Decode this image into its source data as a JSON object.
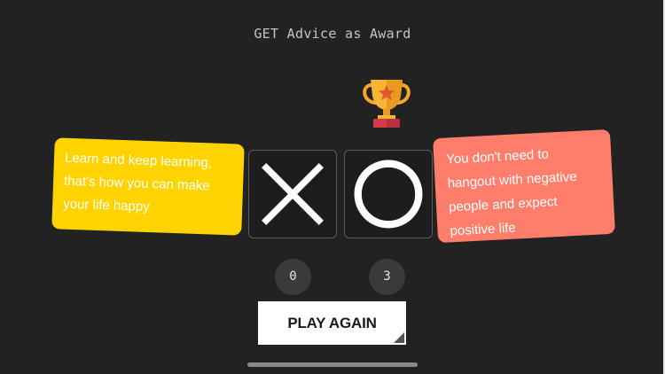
{
  "header": {
    "title": "GET Advice as Award"
  },
  "award": {
    "icon": "trophy-icon"
  },
  "advice": {
    "left": {
      "lines": [
        "Learn and keep learning,",
        "that's how you can make",
        "your life happy"
      ],
      "color": "#ffd300"
    },
    "right": {
      "lines": [
        "You don't need to",
        "hangout with negative",
        "people and expect",
        "positive life"
      ],
      "color": "#ff7e6b"
    }
  },
  "players": {
    "x": {
      "icon": "x-mark-icon",
      "score": "0"
    },
    "o": {
      "icon": "o-mark-icon",
      "score": "3"
    }
  },
  "actions": {
    "play_again_label": "PLAY AGAIN"
  },
  "colors": {
    "background": "#222222",
    "tile_border": "#5b5b5b",
    "button_bg": "#ffffff"
  }
}
